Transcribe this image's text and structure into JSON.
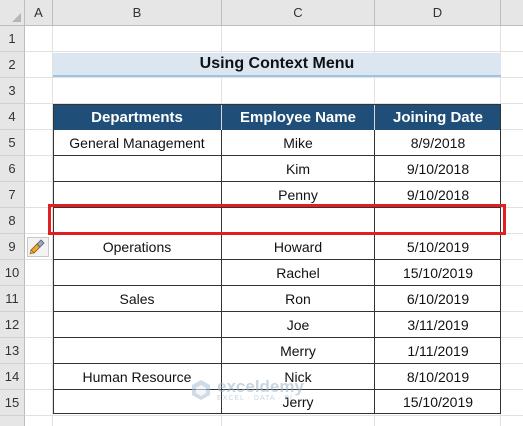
{
  "columns": [
    "A",
    "B",
    "C",
    "D"
  ],
  "rows": [
    "1",
    "2",
    "3",
    "4",
    "5",
    "6",
    "7",
    "8",
    "9",
    "10",
    "11",
    "12",
    "13",
    "14",
    "15"
  ],
  "title": "Using Context Menu",
  "table": {
    "headers": [
      "Departments",
      "Employee Name",
      "Joining Date"
    ],
    "rows": [
      [
        "General Management",
        "Mike",
        "8/9/2018"
      ],
      [
        "",
        "Kim",
        "9/10/2018"
      ],
      [
        "",
        "Penny",
        "9/10/2018"
      ],
      [
        "",
        "",
        ""
      ],
      [
        "Operations",
        "Howard",
        "5/10/2019"
      ],
      [
        "",
        "Rachel",
        "15/10/2019"
      ],
      [
        "Sales",
        "Ron",
        "6/10/2019"
      ],
      [
        "",
        "Joe",
        "3/11/2019"
      ],
      [
        "",
        "Merry",
        "1/11/2019"
      ],
      [
        "Human Resource",
        "Nick",
        "8/10/2019"
      ],
      [
        "",
        "Jerry",
        "15/10/2019"
      ]
    ]
  },
  "watermark": {
    "brand": "exceldemy",
    "sub": "EXCEL · DATA · BI"
  },
  "icons": {
    "paint": "format-painter-icon"
  },
  "colors": {
    "header_fill": "#1f4e79",
    "title_fill": "#dce6f1",
    "highlight": "#e02020"
  }
}
